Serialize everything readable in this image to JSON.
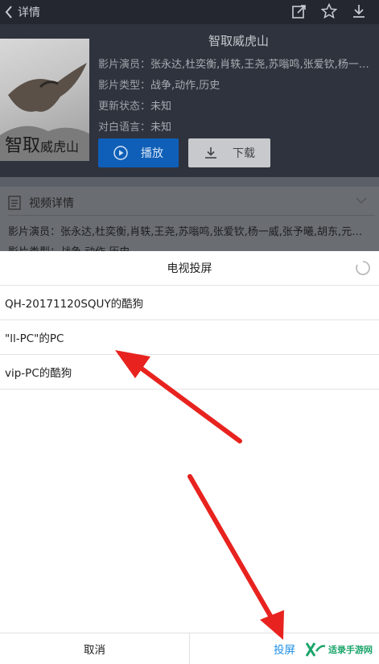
{
  "header": {
    "back_label": "详情",
    "icons": [
      "share-icon",
      "star-icon",
      "download-icon"
    ]
  },
  "movie": {
    "title": "智取威虎山",
    "cast_label": "影片演员：",
    "cast_value": "张永达,杜奕衡,肖轶,王尧,苏嗡鸣,张爱钦,杨一…",
    "genre_label": "影片类型：",
    "genre_value": "战争,动作,历史",
    "update_label": "更新状态：",
    "update_value": "未知",
    "lang_label": "对白语言：",
    "lang_value": "未知",
    "play_label": "播放",
    "download_label": "下载"
  },
  "details": {
    "header": "视频详情",
    "cast_line": "影片演员：张永达,杜奕衡,肖轶,王尧,苏嗡鸣,张爱钦,杨一威,张予曦,胡东,元…",
    "genre_line": "影片类型：战争,动作,历史"
  },
  "cast_sheet": {
    "title": "电视投屏",
    "devices": [
      "QH-20171120SQUY的酷狗",
      "\"ll-PC\"的PC",
      "vip-PC的酷狗"
    ],
    "cancel_label": "取消",
    "cast_label": "投屏"
  },
  "watermark": {
    "text": "适录手游网"
  },
  "colors": {
    "accent_blue": "#0f5fb8",
    "cast_blue": "#1c8ee6",
    "arrow_red": "#e8231f"
  }
}
